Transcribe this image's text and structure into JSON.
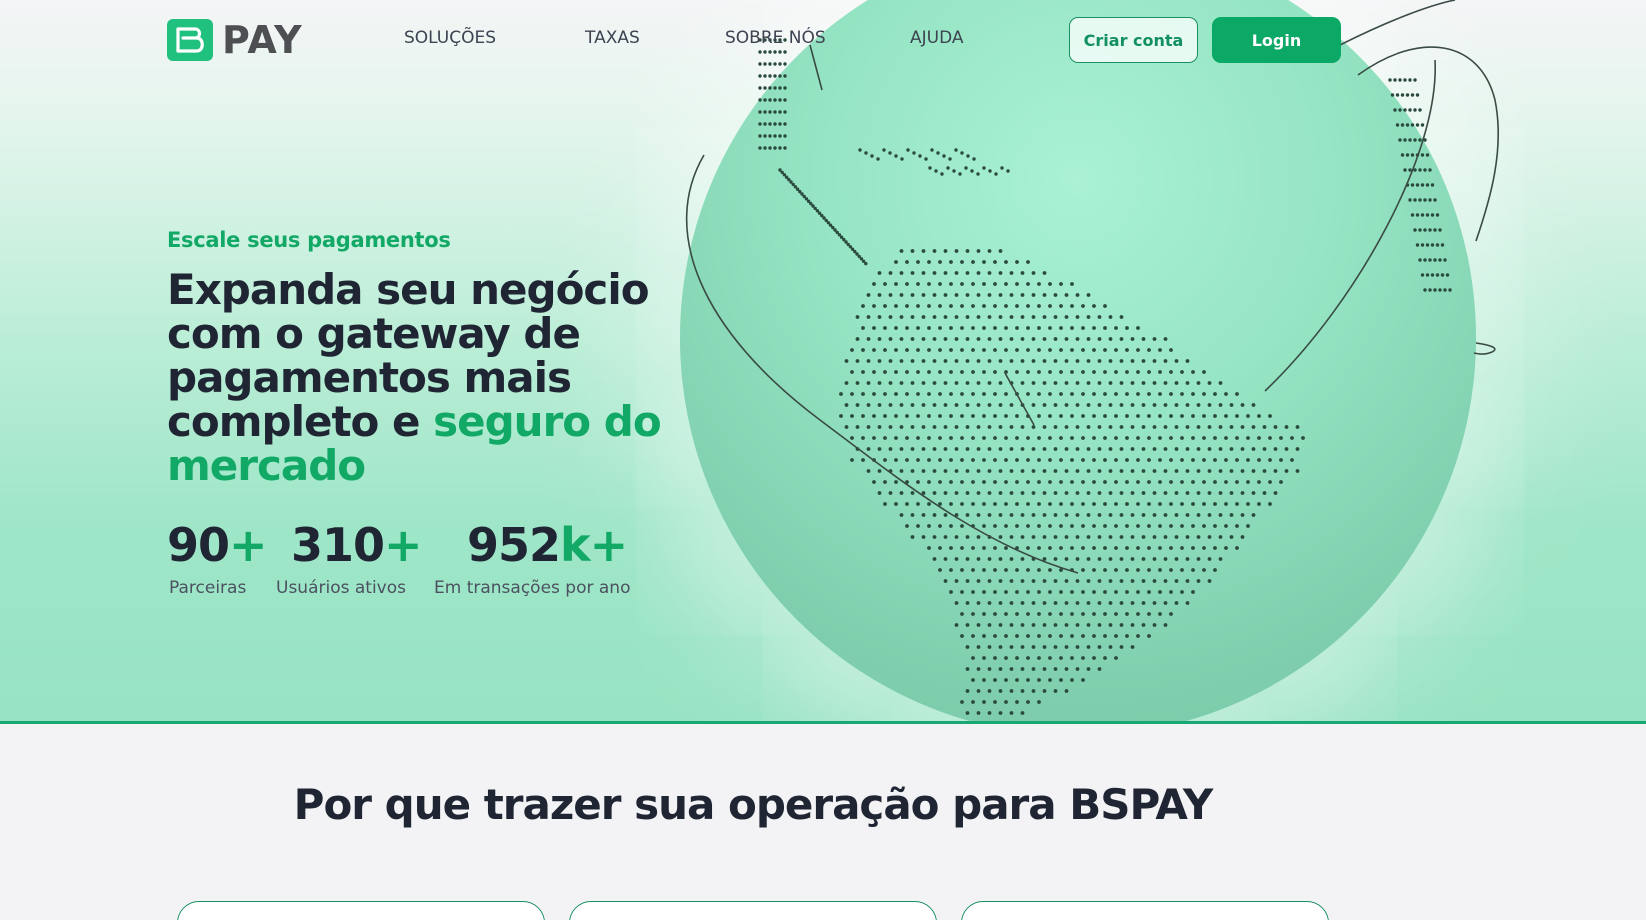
{
  "brand": {
    "logo_text": "PAY",
    "accent_color": "#12a866"
  },
  "nav": {
    "items": [
      {
        "label": "SOLUÇÕES"
      },
      {
        "label": "TAXAS"
      },
      {
        "label": "SOBRE NÓS"
      },
      {
        "label": "AJUDA"
      }
    ]
  },
  "header": {
    "signup_label": "Criar conta",
    "login_label": "Login"
  },
  "hero": {
    "eyebrow": "Escale seus pagamentos",
    "headline_main": "Expanda seu negócio com o gateway de pagamentos mais completo e ",
    "headline_accent": "seguro do mercado",
    "stats": [
      {
        "number": "90",
        "suffix": "+",
        "label": "Parceiras"
      },
      {
        "number": "310",
        "suffix": "+",
        "label": "Usuários ativos"
      },
      {
        "number": "952",
        "suffix": "k+",
        "label": "Em transações por ano"
      }
    ]
  },
  "why": {
    "title": "Por que trazer sua operação para BSPAY"
  }
}
